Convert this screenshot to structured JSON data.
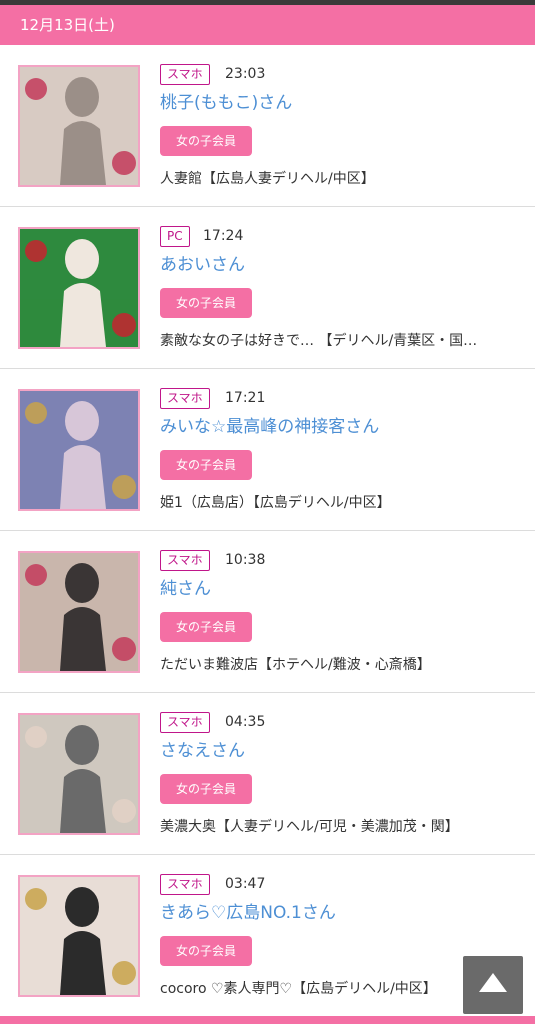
{
  "date_header": "12月13日(土)",
  "member_badge_label": "女の子会員",
  "entries": [
    {
      "device": "スマホ",
      "time": "23:03",
      "name": "桃子(ももこ)さん",
      "shop": "人妻館【広島人妻デリヘル/中区】",
      "photo_colors": [
        "#d8cbc3",
        "#9b8f88",
        "#c33b5b"
      ]
    },
    {
      "device": "PC",
      "time": "17:24",
      "name": "あおいさん",
      "shop": "素敵な女の子は好きで… 【デリヘル/青葉区・国…",
      "photo_colors": [
        "#2e8a3e",
        "#efe7de",
        "#c6232f"
      ]
    },
    {
      "device": "スマホ",
      "time": "17:21",
      "name": "みいな☆最高峰の神接客さん",
      "shop": "姫1（広島店）【広島デリヘル/中区】",
      "photo_colors": [
        "#7d82b3",
        "#d7c6d8",
        "#c8a34a"
      ]
    },
    {
      "device": "スマホ",
      "time": "10:38",
      "name": "純さん",
      "shop": "ただいま難波店【ホテヘル/難波・心斎橋】",
      "photo_colors": [
        "#c9b6ac",
        "#3a3535",
        "#c33b5b"
      ]
    },
    {
      "device": "スマホ",
      "time": "04:35",
      "name": "さなえさん",
      "shop": "美濃大奥【人妻デリヘル/可児・美濃加茂・関】",
      "photo_colors": [
        "#cfc8bf",
        "#6a6a6a",
        "#e3d1c5"
      ]
    },
    {
      "device": "スマホ",
      "time": "03:47",
      "name": "きあら♡広島NO.1さん",
      "shop": "cocoro ♡素人専門♡【広島デリヘル/中区】",
      "photo_colors": [
        "#e8ddd6",
        "#2b2b2b",
        "#c8a34a"
      ]
    }
  ]
}
